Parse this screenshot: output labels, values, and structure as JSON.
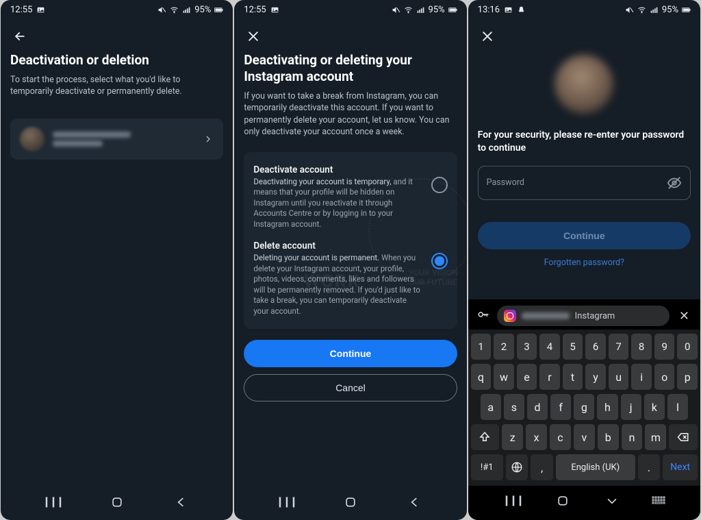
{
  "status": {
    "time1": "12:55",
    "time2": "12:55",
    "time3": "13:16",
    "battery": "95%"
  },
  "screen1": {
    "title": "Deactivation or deletion",
    "subtitle": "To start the process, select what you'd like to temporarily deactivate or permanently delete."
  },
  "screen2": {
    "title": "Deactivating or deleting your Instagram account",
    "intro": "If you want to take a break from Instagram, you can temporarily deactivate this account. If you want to permanently delete your account, let us know.  You can only deactivate your account once a week.",
    "opt1_title": "Deactivate account",
    "opt1_lead": "Deactivating your account is temporary,",
    "opt1_rest": " and it means that your profile will be hidden on Instagram until you reactivate it through Accounts Centre or by logging in to your Instagram account.",
    "opt2_title": "Delete account",
    "opt2_lead": "Deleting your account is permanent.",
    "opt2_rest": " When you delete your Instagram account, your profile, photos, videos, comments, likes and followers will be permanently removed. If you'd just like to take a break, you can temporarily deactivate your account.",
    "continue": "Continue",
    "cancel": "Cancel",
    "selected": "delete"
  },
  "screen3": {
    "prompt": "For your security, please re-enter your password to continue",
    "pw_label": "Password",
    "continue": "Continue",
    "forgot": "Forgotten password?"
  },
  "keyboard": {
    "suggestion_app": "Instagram",
    "space_label": "English (UK)",
    "next_label": "Next",
    "symnum_label": "!#1",
    "row_num": [
      "1",
      "2",
      "3",
      "4",
      "5",
      "6",
      "7",
      "8",
      "9",
      "0"
    ],
    "row1": [
      "q",
      "w",
      "e",
      "r",
      "t",
      "y",
      "u",
      "i",
      "o",
      "p"
    ],
    "row2": [
      "a",
      "s",
      "d",
      "f",
      "g",
      "h",
      "j",
      "k",
      "l"
    ],
    "row3": [
      "z",
      "x",
      "c",
      "v",
      "b",
      "n",
      "m"
    ]
  },
  "watermark": {
    "line1": "WORK",
    "line2a": "YOUR VISION",
    "line2b": "OUR FUTURE"
  }
}
